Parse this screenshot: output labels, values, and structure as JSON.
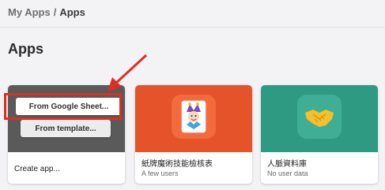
{
  "breadcrumb": {
    "parent": "My Apps",
    "separator": "/",
    "current": "Apps"
  },
  "page": {
    "title": "Apps"
  },
  "create_card": {
    "menu": {
      "from_sheets": "From Google Sheet...",
      "from_template": "From template..."
    },
    "label": "Create app..."
  },
  "apps": [
    {
      "name": "紙牌魔術技能檢核表",
      "subtitle": "A few users",
      "icon": "joker-icon",
      "color": "#e5532b"
    },
    {
      "name": "人脈資料庫",
      "subtitle": "No user data",
      "icon": "handshake-icon",
      "color": "#2f9a82"
    }
  ],
  "annotation": {
    "color": "#e02d22"
  }
}
